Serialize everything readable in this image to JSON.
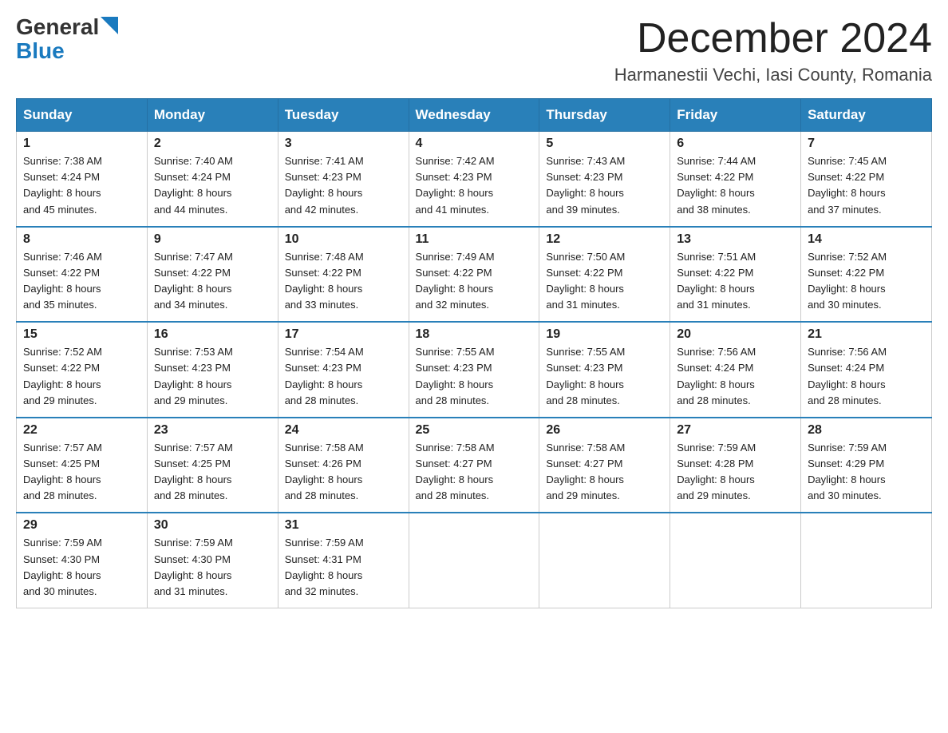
{
  "header": {
    "logo_general": "General",
    "logo_blue": "Blue",
    "month_title": "December 2024",
    "location": "Harmanestii Vechi, Iasi County, Romania"
  },
  "days_of_week": [
    "Sunday",
    "Monday",
    "Tuesday",
    "Wednesday",
    "Thursday",
    "Friday",
    "Saturday"
  ],
  "weeks": [
    [
      {
        "day": "1",
        "sunrise": "7:38 AM",
        "sunset": "4:24 PM",
        "daylight": "8 hours and 45 minutes."
      },
      {
        "day": "2",
        "sunrise": "7:40 AM",
        "sunset": "4:24 PM",
        "daylight": "8 hours and 44 minutes."
      },
      {
        "day": "3",
        "sunrise": "7:41 AM",
        "sunset": "4:23 PM",
        "daylight": "8 hours and 42 minutes."
      },
      {
        "day": "4",
        "sunrise": "7:42 AM",
        "sunset": "4:23 PM",
        "daylight": "8 hours and 41 minutes."
      },
      {
        "day": "5",
        "sunrise": "7:43 AM",
        "sunset": "4:23 PM",
        "daylight": "8 hours and 39 minutes."
      },
      {
        "day": "6",
        "sunrise": "7:44 AM",
        "sunset": "4:22 PM",
        "daylight": "8 hours and 38 minutes."
      },
      {
        "day": "7",
        "sunrise": "7:45 AM",
        "sunset": "4:22 PM",
        "daylight": "8 hours and 37 minutes."
      }
    ],
    [
      {
        "day": "8",
        "sunrise": "7:46 AM",
        "sunset": "4:22 PM",
        "daylight": "8 hours and 35 minutes."
      },
      {
        "day": "9",
        "sunrise": "7:47 AM",
        "sunset": "4:22 PM",
        "daylight": "8 hours and 34 minutes."
      },
      {
        "day": "10",
        "sunrise": "7:48 AM",
        "sunset": "4:22 PM",
        "daylight": "8 hours and 33 minutes."
      },
      {
        "day": "11",
        "sunrise": "7:49 AM",
        "sunset": "4:22 PM",
        "daylight": "8 hours and 32 minutes."
      },
      {
        "day": "12",
        "sunrise": "7:50 AM",
        "sunset": "4:22 PM",
        "daylight": "8 hours and 31 minutes."
      },
      {
        "day": "13",
        "sunrise": "7:51 AM",
        "sunset": "4:22 PM",
        "daylight": "8 hours and 31 minutes."
      },
      {
        "day": "14",
        "sunrise": "7:52 AM",
        "sunset": "4:22 PM",
        "daylight": "8 hours and 30 minutes."
      }
    ],
    [
      {
        "day": "15",
        "sunrise": "7:52 AM",
        "sunset": "4:22 PM",
        "daylight": "8 hours and 29 minutes."
      },
      {
        "day": "16",
        "sunrise": "7:53 AM",
        "sunset": "4:23 PM",
        "daylight": "8 hours and 29 minutes."
      },
      {
        "day": "17",
        "sunrise": "7:54 AM",
        "sunset": "4:23 PM",
        "daylight": "8 hours and 28 minutes."
      },
      {
        "day": "18",
        "sunrise": "7:55 AM",
        "sunset": "4:23 PM",
        "daylight": "8 hours and 28 minutes."
      },
      {
        "day": "19",
        "sunrise": "7:55 AM",
        "sunset": "4:23 PM",
        "daylight": "8 hours and 28 minutes."
      },
      {
        "day": "20",
        "sunrise": "7:56 AM",
        "sunset": "4:24 PM",
        "daylight": "8 hours and 28 minutes."
      },
      {
        "day": "21",
        "sunrise": "7:56 AM",
        "sunset": "4:24 PM",
        "daylight": "8 hours and 28 minutes."
      }
    ],
    [
      {
        "day": "22",
        "sunrise": "7:57 AM",
        "sunset": "4:25 PM",
        "daylight": "8 hours and 28 minutes."
      },
      {
        "day": "23",
        "sunrise": "7:57 AM",
        "sunset": "4:25 PM",
        "daylight": "8 hours and 28 minutes."
      },
      {
        "day": "24",
        "sunrise": "7:58 AM",
        "sunset": "4:26 PM",
        "daylight": "8 hours and 28 minutes."
      },
      {
        "day": "25",
        "sunrise": "7:58 AM",
        "sunset": "4:27 PM",
        "daylight": "8 hours and 28 minutes."
      },
      {
        "day": "26",
        "sunrise": "7:58 AM",
        "sunset": "4:27 PM",
        "daylight": "8 hours and 29 minutes."
      },
      {
        "day": "27",
        "sunrise": "7:59 AM",
        "sunset": "4:28 PM",
        "daylight": "8 hours and 29 minutes."
      },
      {
        "day": "28",
        "sunrise": "7:59 AM",
        "sunset": "4:29 PM",
        "daylight": "8 hours and 30 minutes."
      }
    ],
    [
      {
        "day": "29",
        "sunrise": "7:59 AM",
        "sunset": "4:30 PM",
        "daylight": "8 hours and 30 minutes."
      },
      {
        "day": "30",
        "sunrise": "7:59 AM",
        "sunset": "4:30 PM",
        "daylight": "8 hours and 31 minutes."
      },
      {
        "day": "31",
        "sunrise": "7:59 AM",
        "sunset": "4:31 PM",
        "daylight": "8 hours and 32 minutes."
      },
      null,
      null,
      null,
      null
    ]
  ]
}
